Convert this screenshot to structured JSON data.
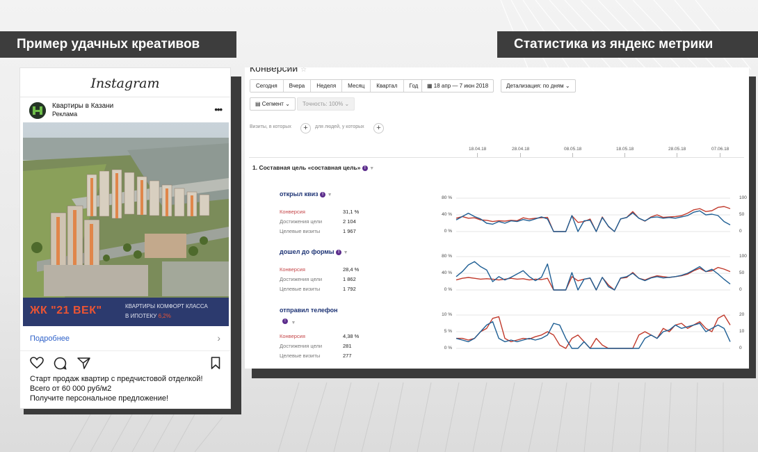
{
  "headings": {
    "left": "Пример удачных креативов",
    "right": "Статистика из яндекс метрики"
  },
  "instagram": {
    "logo": "Instagram",
    "account_name": "Квартиры в Казани",
    "account_sub": "Реклама",
    "banner_title": "ЖК \"21 ВЕК\"",
    "banner_line1": "КВАРТИРЫ КОМФОРТ КЛАССА",
    "banner_line2": "В ИПОТЕКУ",
    "banner_rate": "6,2%",
    "more_link": "Подробнее",
    "caption": [
      "Старт продаж квартир с предчистовой отделкой!",
      "Всего от 60 000 руб/м2",
      "Получите персональное предложение!"
    ],
    "icons": [
      "heart-icon",
      "comment-icon",
      "share-icon",
      "bookmark-icon",
      "more-icon",
      "chevron-right-icon"
    ]
  },
  "metrika": {
    "report_title": "Конверсии",
    "periods": [
      "Сегодня",
      "Вчера",
      "Неделя",
      "Месяц",
      "Квартал",
      "Год"
    ],
    "date_range": "18 апр — 7 июн 2018",
    "detail": "Детализация: по дням",
    "segment": "Сегмент",
    "accuracy": "Точность: 100%",
    "filter_visits": "Визиты, в которых",
    "filter_people": "для людей, у которых",
    "date_ticks": [
      "18.04.18",
      "28.04.18",
      "08.05.18",
      "18.05.18",
      "28.05.18",
      "07.06.18"
    ],
    "goal_title": "1. Составная цель «составная цель»",
    "stat_labels": {
      "conv": "Конверсия",
      "reach": "Достижения цели",
      "visits": "Целевые визиты"
    },
    "colors": {
      "conversion": "#c0392b",
      "visits": "#1f5f94"
    },
    "goals": [
      {
        "name": "открыл квиз",
        "conversion": "31,1 %",
        "reaches": "2 104",
        "visits": "1 967",
        "y_left": [
          "80 %",
          "40 %",
          "0 %"
        ],
        "y_right": [
          "100",
          "50",
          "0"
        ]
      },
      {
        "name": "дошел до формы",
        "conversion": "28,4 %",
        "reaches": "1 862",
        "visits": "1 792",
        "y_left": [
          "80 %",
          "40 %",
          "0 %"
        ],
        "y_right": [
          "100",
          "50",
          "0"
        ]
      },
      {
        "name": "отправил телефон",
        "conversion": "4,38 %",
        "reaches": "281",
        "visits": "277",
        "y_left": [
          "10 %",
          "5 %",
          "0 %"
        ],
        "y_right": [
          "20",
          "10",
          "0"
        ]
      }
    ]
  },
  "chart_data": [
    {
      "type": "line",
      "title": "открыл квиз",
      "ylim_left": [
        0,
        80
      ],
      "ylim_right": [
        0,
        100
      ],
      "series": [
        {
          "name": "Конверсия",
          "axis": "left",
          "values": [
            32,
            36,
            32,
            33,
            28,
            27,
            24,
            26,
            25,
            27,
            26,
            33,
            30,
            32,
            33,
            34,
            0,
            0,
            0,
            38,
            22,
            24,
            30,
            0,
            35,
            12,
            0,
            30,
            34,
            48,
            32,
            25,
            35,
            40,
            34,
            35,
            36,
            38,
            44,
            52,
            55,
            48,
            50,
            58,
            60,
            55
          ]
        },
        {
          "name": "Целевые визиты",
          "axis": "right",
          "values": [
            35,
            45,
            55,
            45,
            38,
            25,
            22,
            30,
            25,
            32,
            30,
            36,
            32,
            38,
            44,
            38,
            0,
            0,
            0,
            48,
            0,
            32,
            34,
            0,
            42,
            16,
            0,
            38,
            42,
            56,
            40,
            32,
            42,
            44,
            40,
            42,
            40,
            44,
            48,
            58,
            62,
            50,
            52,
            48,
            30,
            20
          ]
        }
      ]
    },
    {
      "type": "line",
      "title": "дошел до формы",
      "ylim_left": [
        0,
        80
      ],
      "ylim_right": [
        0,
        100
      ],
      "series": [
        {
          "name": "Конверсия",
          "axis": "left",
          "values": [
            24,
            28,
            30,
            28,
            26,
            27,
            26,
            24,
            26,
            28,
            26,
            27,
            24,
            26,
            25,
            28,
            0,
            0,
            0,
            32,
            22,
            26,
            28,
            0,
            30,
            12,
            0,
            28,
            30,
            42,
            28,
            24,
            30,
            34,
            32,
            30,
            32,
            34,
            38,
            46,
            52,
            44,
            46,
            54,
            50,
            44
          ]
        },
        {
          "name": "Целевые визиты",
          "axis": "right",
          "values": [
            40,
            55,
            75,
            85,
            70,
            60,
            25,
            40,
            30,
            38,
            48,
            58,
            40,
            28,
            38,
            78,
            0,
            0,
            0,
            52,
            0,
            32,
            36,
            0,
            38,
            10,
            0,
            36,
            40,
            50,
            35,
            28,
            36,
            40,
            36,
            38,
            40,
            44,
            50,
            60,
            70,
            55,
            62,
            48,
            32,
            18
          ]
        }
      ]
    },
    {
      "type": "line",
      "title": "отправил телефон",
      "ylim_left": [
        0,
        10
      ],
      "ylim_right": [
        0,
        20
      ],
      "series": [
        {
          "name": "Конверсия",
          "axis": "left",
          "values": [
            3,
            3,
            2.5,
            3,
            5,
            6,
            9,
            9.5,
            3,
            2,
            2.5,
            3,
            2.8,
            3.5,
            4,
            5,
            4,
            1,
            0,
            3,
            4,
            2,
            0,
            3,
            1,
            0,
            0,
            0,
            0,
            0,
            4,
            5,
            4,
            3,
            6,
            5,
            7,
            7.5,
            6,
            7,
            8,
            6,
            5,
            9,
            10,
            7
          ]
        },
        {
          "name": "Целевые визиты",
          "axis": "right",
          "values": [
            6,
            5,
            4,
            6,
            10,
            14,
            16,
            6,
            4,
            5,
            4,
            5,
            6,
            5,
            6,
            8,
            15,
            14,
            6,
            0,
            0,
            4,
            0,
            0,
            0,
            0,
            0,
            0,
            0,
            0,
            0,
            6,
            8,
            6,
            10,
            11,
            14,
            12,
            13,
            14,
            15,
            10,
            12,
            14,
            12,
            4
          ]
        }
      ]
    }
  ]
}
